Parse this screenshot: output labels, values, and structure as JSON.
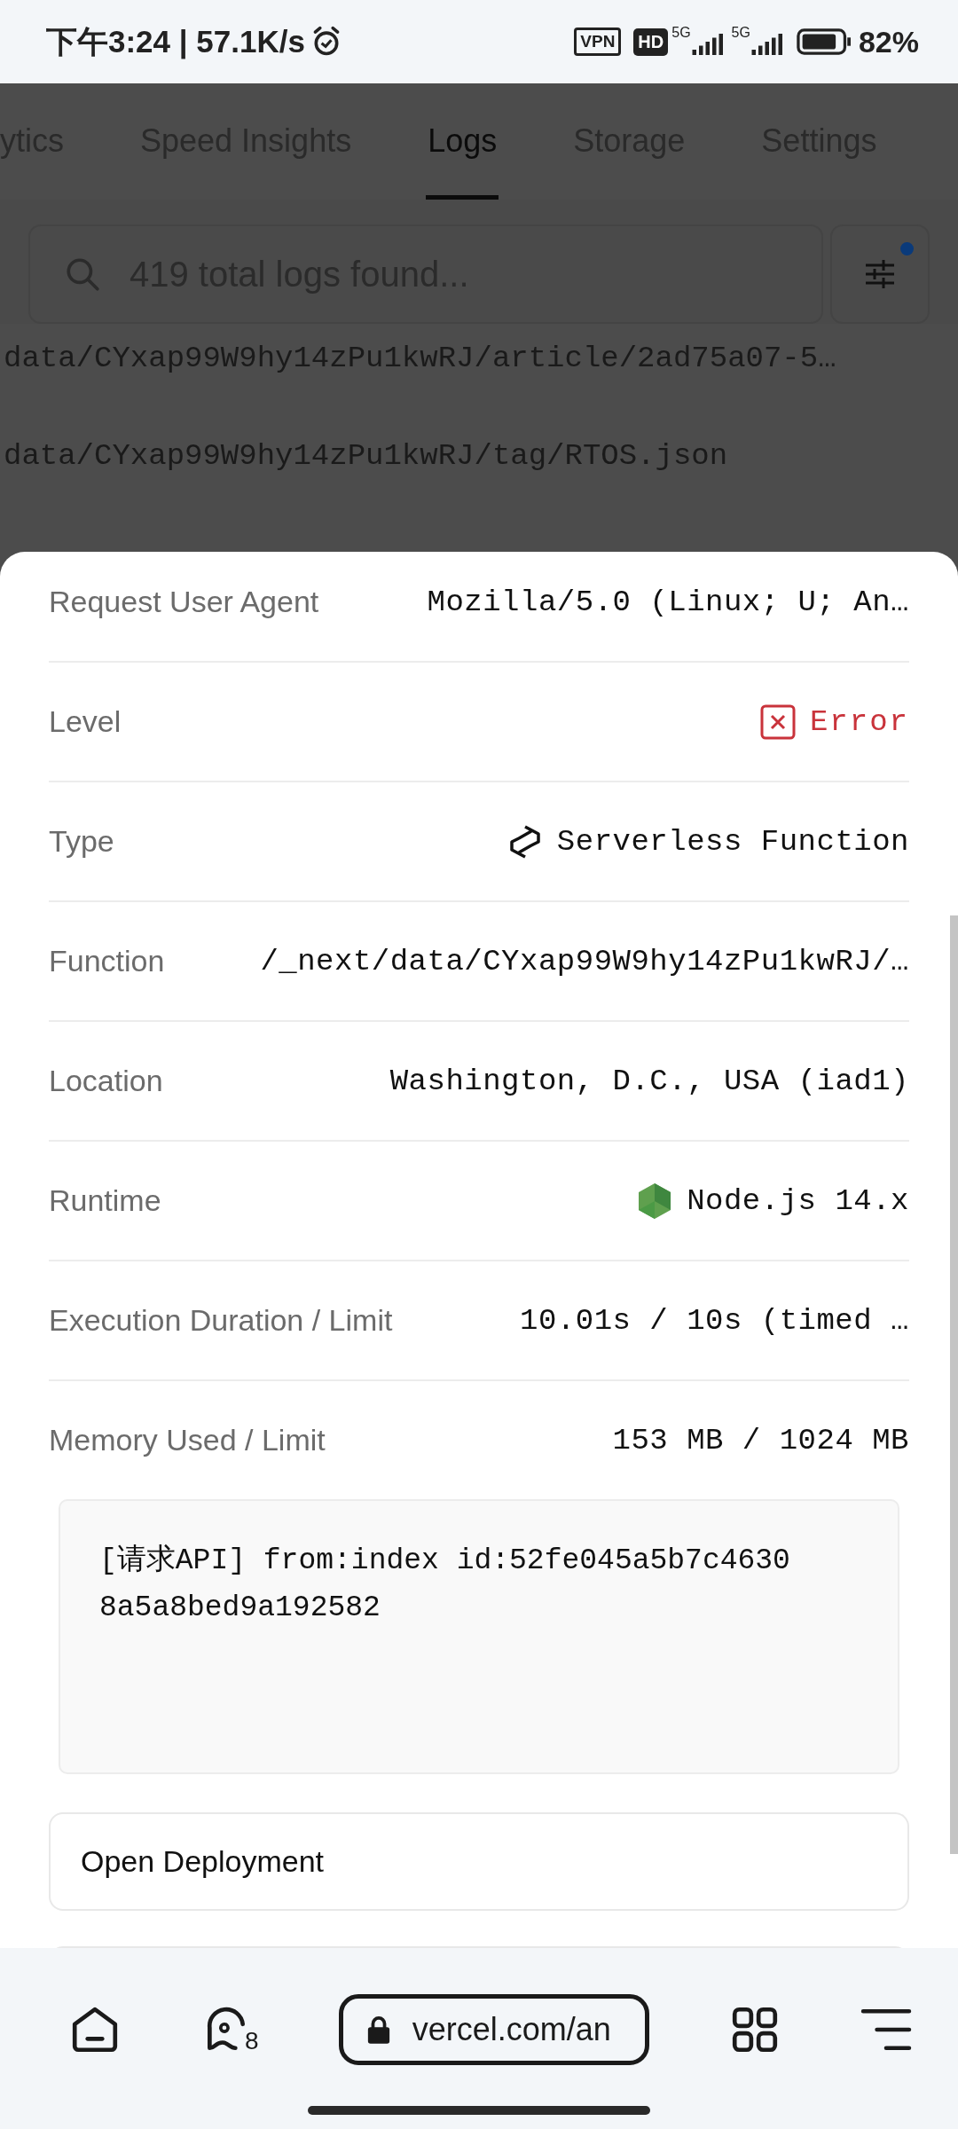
{
  "status_bar": {
    "time": "下午3:24 | 57.1K/s",
    "vpn": "VPN",
    "hd": "HD",
    "network_1": "5G",
    "network_2": "5G",
    "battery": "82%"
  },
  "tabs": [
    {
      "label": "ytics",
      "selected": false
    },
    {
      "label": "Speed Insights",
      "selected": false
    },
    {
      "label": "Logs",
      "selected": true
    },
    {
      "label": "Storage",
      "selected": false
    },
    {
      "label": "Settings",
      "selected": false
    }
  ],
  "search": {
    "placeholder": "419 total logs found...",
    "filters_applied": true
  },
  "log_rows": [
    "data/CYxap99W9hy14zPu1kwRJ/article/2ad75a07-5…",
    "data/CYxap99W9hy14zPu1kwRJ/tag/RTOS.json"
  ],
  "details": [
    {
      "label": "Request User Agent",
      "value": "Mozilla/5.0 (Linux; U; An…",
      "kind": "text"
    },
    {
      "label": "Level",
      "value": "Error",
      "kind": "level"
    },
    {
      "label": "Type",
      "value": "Serverless Function",
      "kind": "type"
    },
    {
      "label": "Function",
      "value": "/_next/data/CYxap99W9hy14zPu1kwRJ/…",
      "kind": "text"
    },
    {
      "label": "Location",
      "value": "Washington, D.C., USA (iad1)",
      "kind": "text"
    },
    {
      "label": "Runtime",
      "value": "Node.js 14.x",
      "kind": "runtime"
    },
    {
      "label": "Execution Duration / Limit",
      "value": "10.01s / 10s (timed …",
      "kind": "text"
    },
    {
      "label": "Memory Used / Limit",
      "value": "153 MB / 1024 MB",
      "kind": "text"
    }
  ],
  "message": "[请求API] from:index id:52fe045a5b7c46308a5a8bed9a192582",
  "actions": [
    "Open Deployment"
  ],
  "browser_bar": {
    "tab_count": "8",
    "url": "vercel.com/an"
  }
}
